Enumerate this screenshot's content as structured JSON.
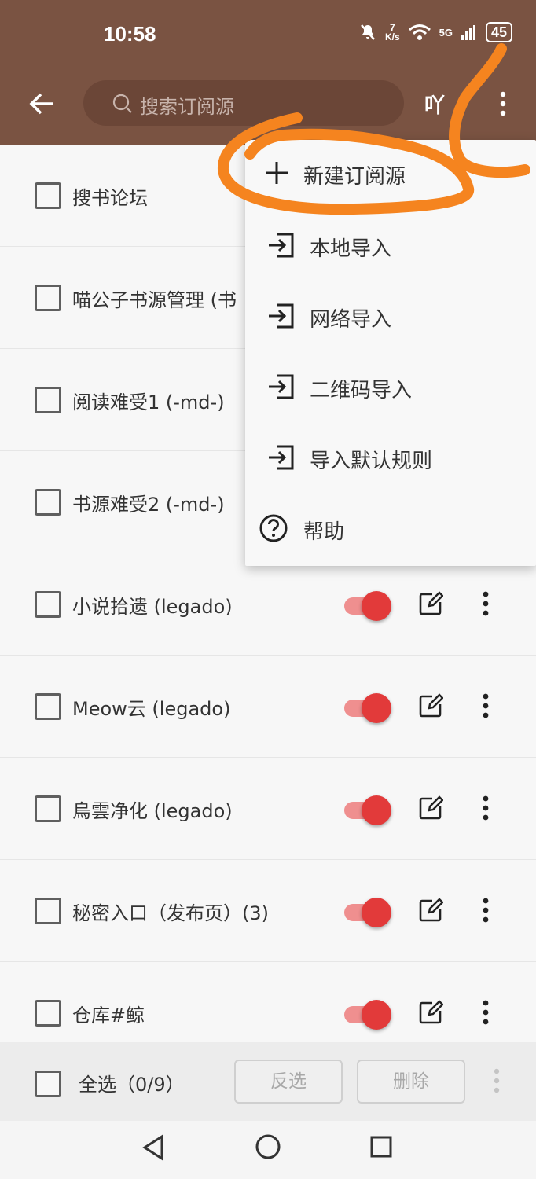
{
  "status_bar": {
    "time": "10:58",
    "net_speed_value": "7",
    "net_speed_unit": "K/s",
    "signal_label": "5G",
    "battery": "45"
  },
  "toolbar": {
    "search_placeholder": "搜索订阅源",
    "extra_label": "吖",
    "background_color": "#7a5342"
  },
  "menu": {
    "items": [
      {
        "label": "新建订阅源",
        "icon": "plus-icon"
      },
      {
        "label": "本地导入",
        "icon": "import-icon"
      },
      {
        "label": "网络导入",
        "icon": "import-icon"
      },
      {
        "label": "二维码导入",
        "icon": "import-icon"
      },
      {
        "label": "导入默认规则",
        "icon": "import-icon"
      },
      {
        "label": "帮助",
        "icon": "help-icon"
      }
    ]
  },
  "list": {
    "items": [
      {
        "label": "搜书论坛",
        "enabled": true
      },
      {
        "label": "喵公子书源管理 (书",
        "enabled": true
      },
      {
        "label": "阅读难受1 (-md-)",
        "enabled": true
      },
      {
        "label": "书源难受2 (-md-)",
        "enabled": true
      },
      {
        "label": "小说拾遗 (legado)",
        "enabled": true
      },
      {
        "label": "Meow云 (legado)",
        "enabled": true
      },
      {
        "label": "烏雲净化 (legado)",
        "enabled": true
      },
      {
        "label": "秘密入口（发布页）(3)",
        "enabled": true
      },
      {
        "label": "仓库#鲸",
        "enabled": true
      }
    ],
    "switch_on_color": "#e23a3a"
  },
  "bottom_bar": {
    "select_all": "全选（0/9）",
    "invert_label": "反选",
    "delete_label": "删除"
  },
  "annotation_color": "#f5841f"
}
